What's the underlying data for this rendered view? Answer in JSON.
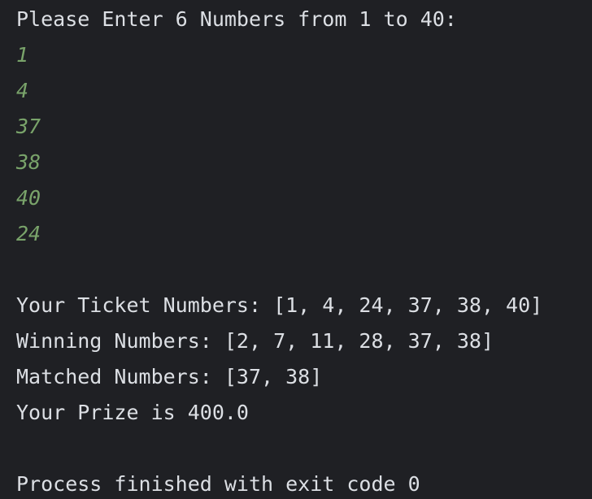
{
  "console": {
    "prompt": "Please Enter 6 Numbers from 1 to 40:",
    "inputs": [
      "1",
      "4",
      "37",
      "38",
      "40",
      "24"
    ],
    "ticket_line": "Your Ticket Numbers: [1, 4, 24, 37, 38, 40]",
    "winning_line": "Winning Numbers: [2, 7, 11, 28, 37, 38]",
    "matched_line": "Matched Numbers: [37, 38]",
    "prize_line": "Your Prize is 400.0",
    "exit_line": "Process finished with exit code 0"
  },
  "colors": {
    "background": "#1f2024",
    "text": "#dcdfe4",
    "input": "#79a36a"
  }
}
